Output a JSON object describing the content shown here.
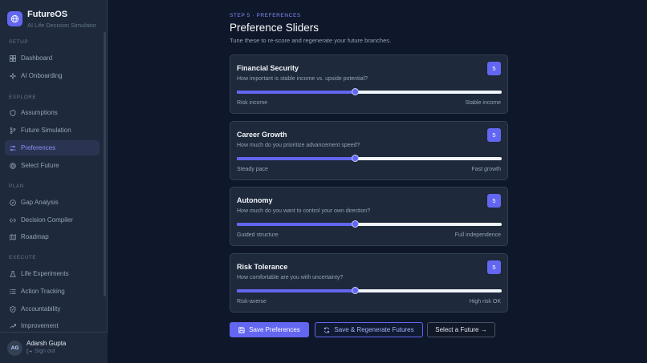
{
  "brand": {
    "name": "FutureOS",
    "subtitle": "AI Life Decision Simulator"
  },
  "nav": {
    "sections": [
      {
        "label": "SETUP",
        "items": [
          {
            "label": "Dashboard",
            "icon": "grid-icon"
          },
          {
            "label": "AI Onboarding",
            "icon": "sparkle-icon"
          }
        ]
      },
      {
        "label": "EXPLORE",
        "items": [
          {
            "label": "Assumptions",
            "icon": "shield-icon"
          },
          {
            "label": "Future Simulation",
            "icon": "branch-icon"
          },
          {
            "label": "Preferences",
            "icon": "sliders-icon",
            "active": true
          },
          {
            "label": "Select Future",
            "icon": "target-icon"
          }
        ]
      },
      {
        "label": "PLAN",
        "items": [
          {
            "label": "Gap Analysis",
            "icon": "compass-icon"
          },
          {
            "label": "Decision Compiler",
            "icon": "compiler-icon"
          },
          {
            "label": "Roadmap",
            "icon": "map-icon"
          }
        ]
      },
      {
        "label": "EXECUTE",
        "items": [
          {
            "label": "Life Experiments",
            "icon": "flask-icon"
          },
          {
            "label": "Action Tracking",
            "icon": "list-icon"
          },
          {
            "label": "Accountability",
            "icon": "shield-check-icon"
          },
          {
            "label": "Improvement",
            "icon": "trend-up-icon"
          }
        ]
      }
    ]
  },
  "user": {
    "initials": "AG",
    "name": "Adarsh Gupta",
    "signout": "Sign out"
  },
  "page": {
    "step": "STEP 5 · PREFERENCES",
    "title": "Preference Sliders",
    "subtitle": "Tune these to re-score and regenerate your future branches."
  },
  "sliders": [
    {
      "title": "Financial Security",
      "question": "How important is stable income vs. upside potential?",
      "value": "5",
      "min_label": "Risk income",
      "max_label": "Stable income",
      "fraction": 0.445
    },
    {
      "title": "Career Growth",
      "question": "How much do you prioritize advancement speed?",
      "value": "5",
      "min_label": "Steady pace",
      "max_label": "Fast growth",
      "fraction": 0.445
    },
    {
      "title": "Autonomy",
      "question": "How much do you want to control your own direction?",
      "value": "5",
      "min_label": "Guided structure",
      "max_label": "Full independence",
      "fraction": 0.445
    },
    {
      "title": "Risk Tolerance",
      "question": "How comfortable are you with uncertainty?",
      "value": "5",
      "min_label": "Risk-averse",
      "max_label": "High risk OK",
      "fraction": 0.445
    }
  ],
  "actions": {
    "save": "Save Preferences",
    "regenerate": "Save & Regenerate Futures",
    "select": "Select a Future →"
  },
  "colors": {
    "accent": "#6366f1",
    "background": "#0f172a",
    "panel": "#1e293b"
  }
}
